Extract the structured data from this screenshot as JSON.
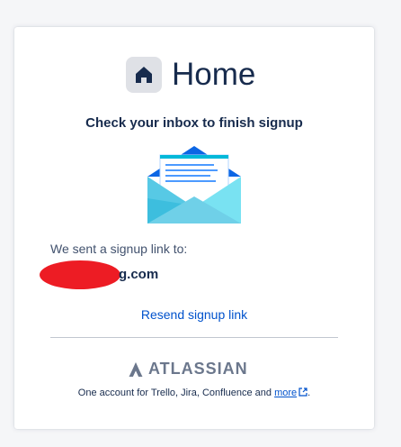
{
  "brand": {
    "app_name": "Home",
    "icon": "home-icon"
  },
  "heading": "Check your inbox to finish signup",
  "illustration": "envelope-icon",
  "sent_label": "We sent a signup link to:",
  "email_visible": "g.com",
  "resend_link": "Resend signup link",
  "atlassian": {
    "wordmark": "ATLASSIAN",
    "icon": "atlassian-logo-icon"
  },
  "footer": {
    "text": "One account for Trello, Jira, Confluence and ",
    "link": "more",
    "link_icon": "external-link-icon",
    "suffix": "."
  },
  "colors": {
    "link": "#0052cc",
    "text": "#172b4d",
    "redaction": "#ed1c24",
    "envelope": "#6fd0e8"
  }
}
